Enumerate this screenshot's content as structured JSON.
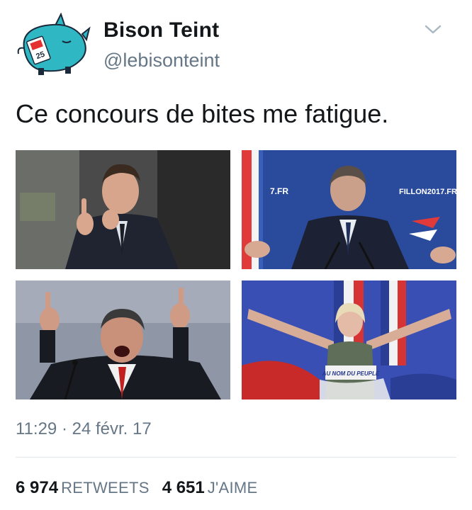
{
  "tweet": {
    "author_name": "Bison Teint",
    "author_handle": "@lebisonteint",
    "avatar_badge": "25",
    "text": "Ce concours de bites me fatigue.",
    "timestamp": "11:29 · 24 févr. 17",
    "retweets_count": "6 974",
    "retweets_label": "RETWEETS",
    "likes_count": "4 651",
    "likes_label": "J'AIME"
  },
  "photos": [
    {
      "name": "photo-man-pointing-finger",
      "caption": ""
    },
    {
      "name": "photo-man-at-podium",
      "sign_left": "7.FR",
      "sign_right": "FILLON2017.FR"
    },
    {
      "name": "photo-man-shouting-fingers-raised",
      "caption": ""
    },
    {
      "name": "photo-woman-arms-outstretched",
      "podium_text": "AU NOM DU PEUPLE"
    }
  ],
  "icons": {
    "menu": "chevron-down-icon",
    "avatar": "bison-avatar-icon"
  },
  "colors": {
    "text": "#14171a",
    "secondary": "#657786",
    "avatar": "#2fb8c4",
    "divider": "#e1e8ed"
  }
}
